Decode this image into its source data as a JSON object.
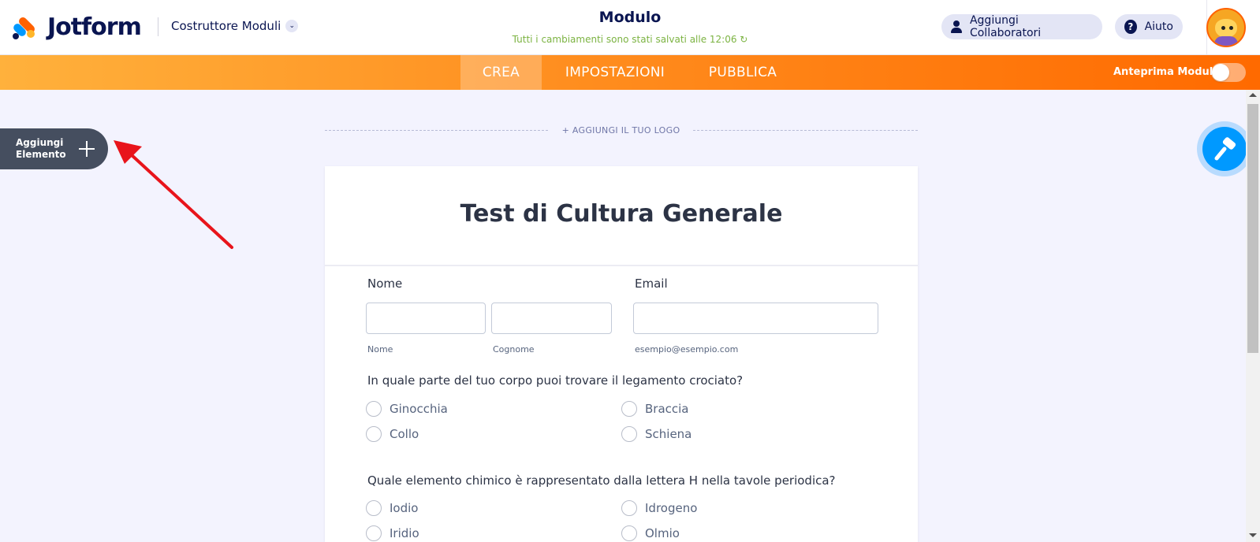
{
  "header": {
    "logo_text": "Jotform",
    "builder_menu": "Costruttore Moduli",
    "form_title": "Modulo",
    "save_status": "Tutti i cambiamenti sono stati salvati alle 12:06 ↻",
    "collaborators_label": "Aggiungi Collaboratori",
    "help_label": "Aiuto",
    "help_icon_glyph": "?",
    "chevron_glyph": "⌄"
  },
  "nav": {
    "tabs": [
      {
        "label": "CREA",
        "active": true
      },
      {
        "label": "IMPOSTAZIONI",
        "active": false
      },
      {
        "label": "PUBBLICA",
        "active": false
      }
    ],
    "preview_label": "Anteprima Modulo",
    "preview_enabled": false
  },
  "sidebar": {
    "add_element_label": "Aggiungi Elemento"
  },
  "canvas": {
    "add_logo_label": "+ AGGIUNGI IL TUO LOGO"
  },
  "form": {
    "title": "Test di Cultura Generale",
    "name_label": "Nome",
    "first_name_sublabel": "Nome",
    "last_name_sublabel": "Cognome",
    "email_label": "Email",
    "email_sublabel": "esempio@esempio.com",
    "questions": [
      {
        "text": "In quale parte del tuo corpo puoi trovare il legamento crociato?",
        "options": [
          "Ginocchia",
          "Braccia",
          "Collo",
          "Schiena"
        ]
      },
      {
        "text": "Quale elemento chimico è rappresentato dalla lettera H nella tavole periodica?",
        "options": [
          "Iodio",
          "Idrogeno",
          "Iridio",
          "Olmio"
        ]
      }
    ]
  },
  "colors": {
    "brand_navy": "#0a1551",
    "brand_orange": "#ff6100",
    "brand_blue": "#0099ff",
    "saved_green": "#7cb342",
    "arrow_red": "#e8141b"
  },
  "icons": {
    "collaborator": "user-icon",
    "help": "question-circle-icon",
    "add": "plus-icon",
    "designer": "paint-roller-icon"
  }
}
